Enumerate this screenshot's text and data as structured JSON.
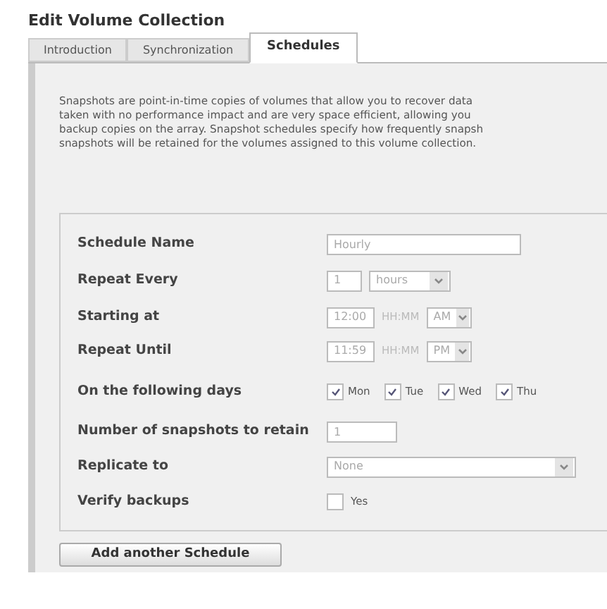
{
  "window": {
    "title": "Edit Volume Collection"
  },
  "tabs": [
    {
      "label": "Introduction",
      "selected": false
    },
    {
      "label": "Synchronization",
      "selected": false
    },
    {
      "label": "Schedules",
      "selected": true
    }
  ],
  "description": [
    "Snapshots are point-in-time copies of volumes that allow you to recover data",
    "taken with no performance impact and are very space efficient, allowing you",
    "backup copies on the array. Snapshot schedules specify how frequently snapsh",
    "snapshots will be retained for the volumes assigned to this volume collection."
  ],
  "schedule": {
    "name": {
      "label": "Schedule Name",
      "value": "Hourly"
    },
    "repeat_every": {
      "label": "Repeat Every",
      "value": "1",
      "unit": "hours"
    },
    "starting_at": {
      "label": "Starting at",
      "time": "12:00",
      "format": "HH:MM",
      "ampm": "AM"
    },
    "repeat_until": {
      "label": "Repeat Until",
      "time": "11:59",
      "format": "HH:MM",
      "ampm": "PM"
    },
    "days": {
      "label": "On the following days",
      "items": [
        {
          "label": "Mon",
          "checked": true
        },
        {
          "label": "Tue",
          "checked": true
        },
        {
          "label": "Wed",
          "checked": true
        },
        {
          "label": "Thu",
          "checked": true
        }
      ]
    },
    "retain": {
      "label": "Number of snapshots to retain",
      "value": "1"
    },
    "replicate": {
      "label": "Replicate to",
      "value": "None"
    },
    "verify": {
      "label": "Verify backups",
      "option": "Yes",
      "checked": false
    }
  },
  "add_button": "Add another Schedule"
}
